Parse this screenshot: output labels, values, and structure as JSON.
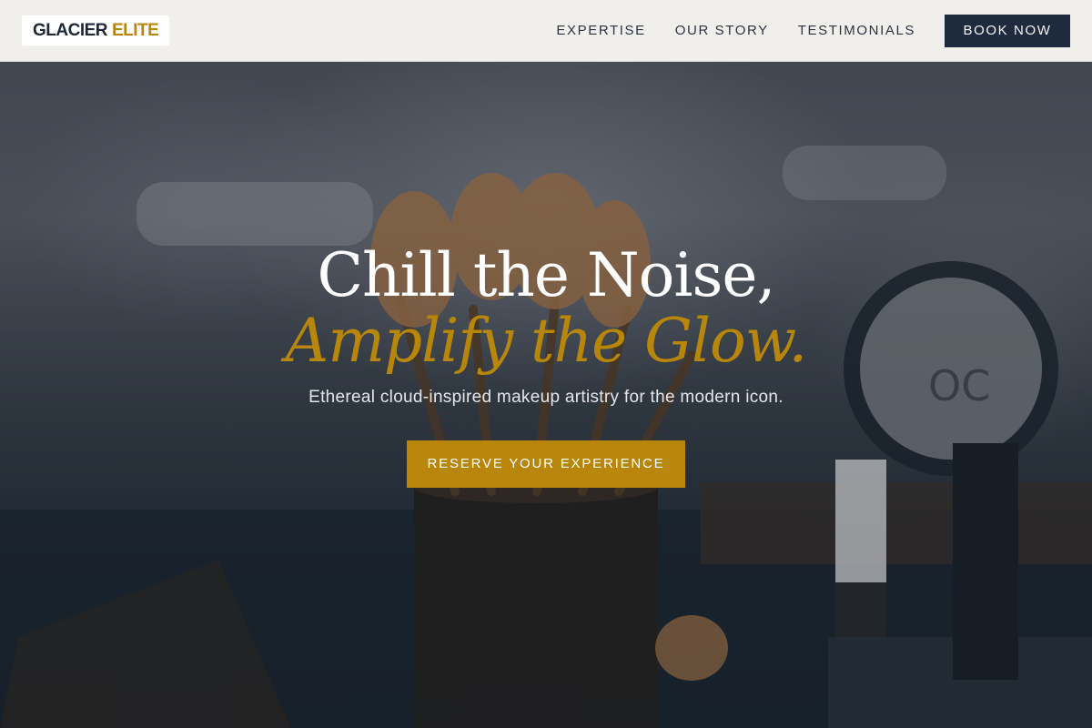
{
  "brand": {
    "name_part1": "GLACIER",
    "name_part2": "ELITE"
  },
  "nav": {
    "links": [
      {
        "label": "EXPERTISE"
      },
      {
        "label": "OUR STORY"
      },
      {
        "label": "TESTIMONIALS"
      }
    ],
    "cta_label": "BOOK NOW"
  },
  "hero": {
    "headline_line1": "Chill the Noise,",
    "headline_line2": "Amplify the Glow.",
    "subtitle": "Ethereal cloud-inspired makeup artistry for the modern icon.",
    "cta_label": "RESERVE YOUR EXPERIENCE"
  },
  "colors": {
    "accent_gold": "#b8860b",
    "navy": "#1e2a3e",
    "nav_bg": "#f6f5f2"
  }
}
